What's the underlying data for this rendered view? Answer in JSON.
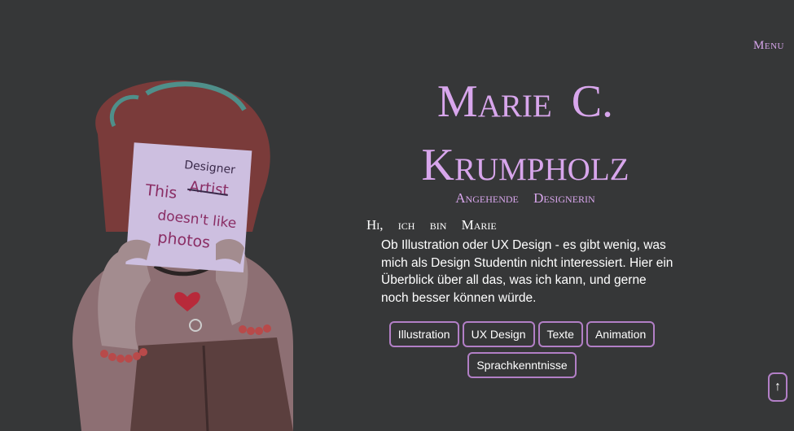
{
  "nav": {
    "menu_label": "Menu"
  },
  "hero": {
    "title_line1": "Marie C.",
    "title_line2": "Krumpholz",
    "subtitle": "Angehende Designerin",
    "greeting": "Hi, ich bin Marie",
    "intro": "Ob Illustration oder UX Design - es gibt wenig, was mich als Design Studentin nicht interessiert. Hier ein Überblick über all das, was ich kann, und gerne noch besser können würde."
  },
  "illustration": {
    "sign_line1": "This",
    "sign_struck": "Artist",
    "sign_insert": "Designer",
    "sign_line2": "doesn't like",
    "sign_line3": "photos"
  },
  "tags": [
    "Illustration",
    "UX Design",
    "Texte",
    "Animation",
    "Sprachkenntnisse"
  ],
  "scroll_top": {
    "icon": "↑"
  },
  "colors": {
    "background": "#363738",
    "accent": "#d8a6ec",
    "border": "#b27fc6"
  }
}
